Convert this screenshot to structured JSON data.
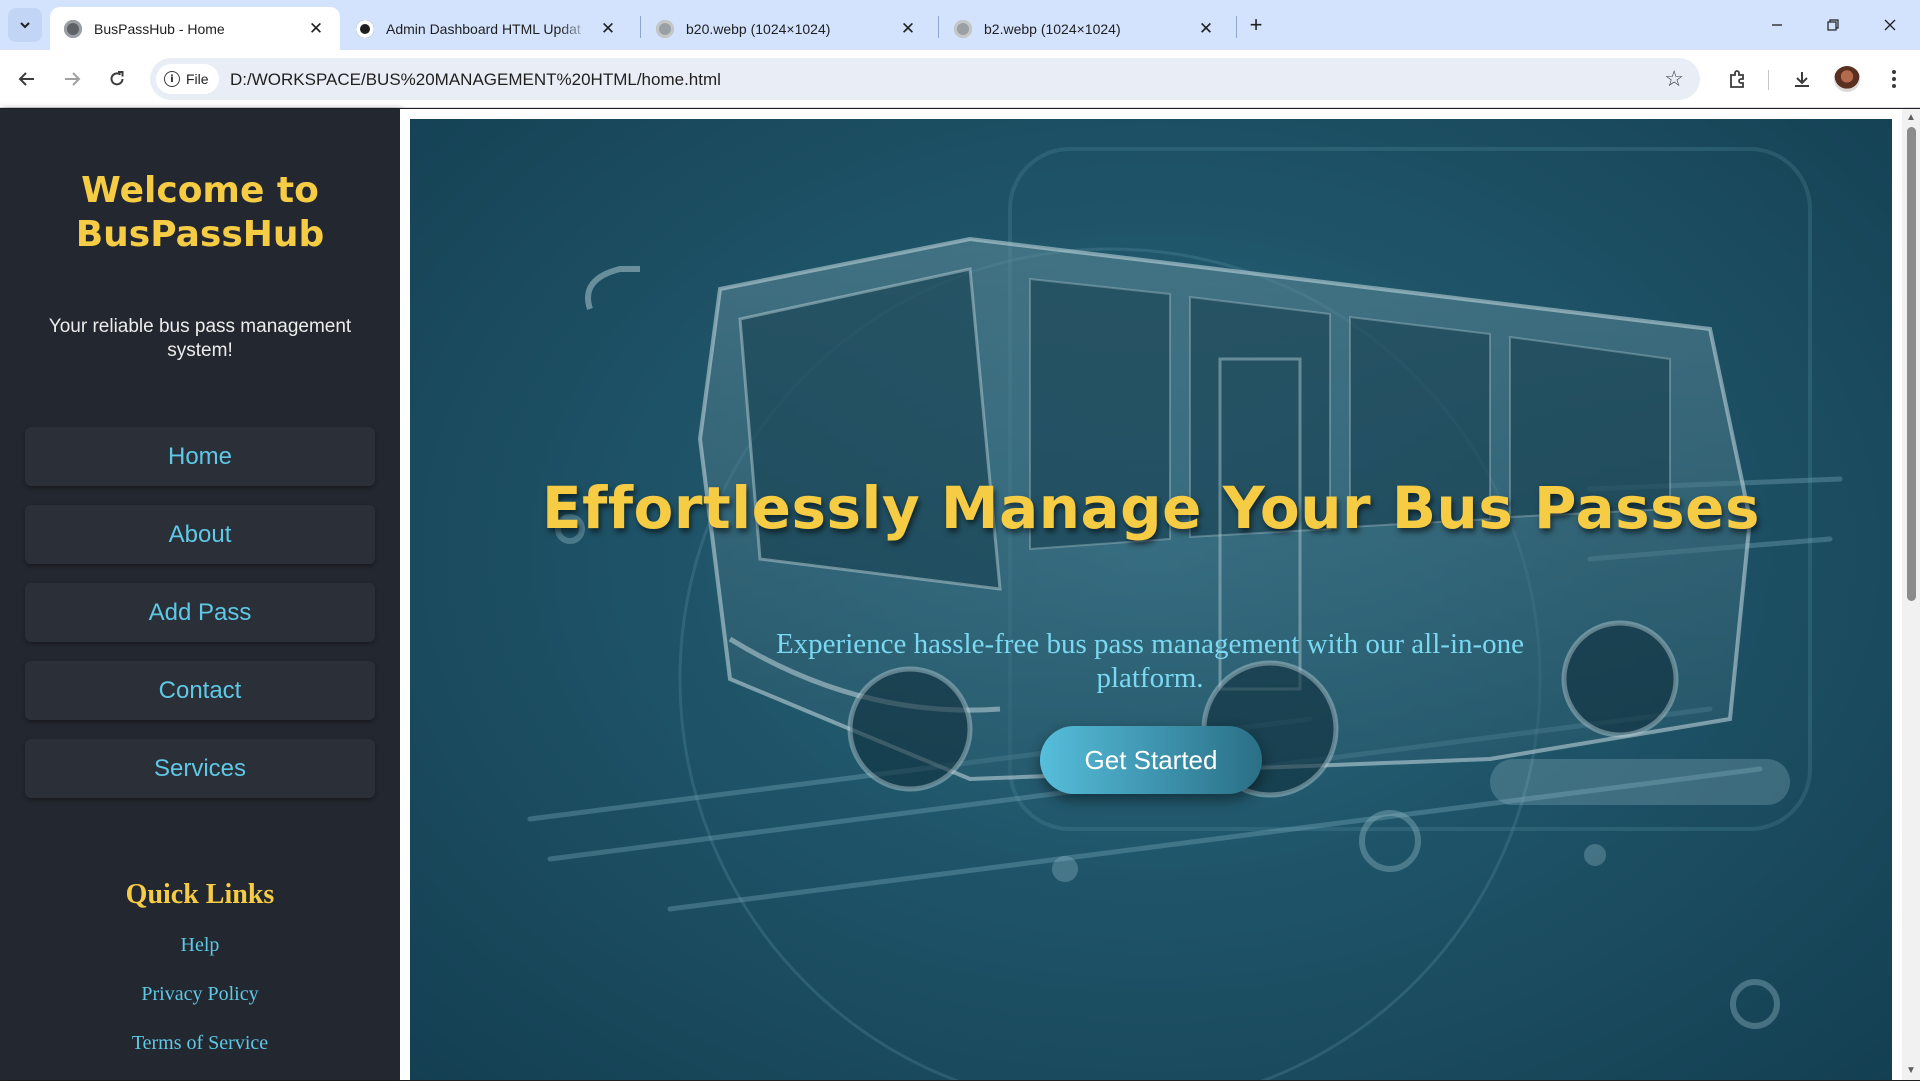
{
  "browser": {
    "tabs": [
      {
        "title": "BusPassHub - Home",
        "active": true,
        "icon": "globe-icon"
      },
      {
        "title": "Admin Dashboard HTML Updat",
        "active": false,
        "icon": "openai-icon"
      },
      {
        "title": "b20.webp (1024×1024)",
        "active": false,
        "icon": "globe-icon"
      },
      {
        "title": "b2.webp (1024×1024)",
        "active": false,
        "icon": "globe-icon"
      }
    ],
    "address": {
      "chip_label": "File",
      "url": "D:/WORKSPACE/BUS%20MANAGEMENT%20HTML/home.html"
    }
  },
  "sidebar": {
    "brand_line1": "Welcome to",
    "brand_line2": "BusPassHub",
    "tagline": "Your reliable bus pass management system!",
    "nav": [
      {
        "label": "Home"
      },
      {
        "label": "About"
      },
      {
        "label": "Add Pass"
      },
      {
        "label": "Contact"
      },
      {
        "label": "Services"
      }
    ],
    "quick_links_title": "Quick Links",
    "quick_links": [
      {
        "label": "Help"
      },
      {
        "label": "Privacy Policy"
      },
      {
        "label": "Terms of Service"
      }
    ]
  },
  "hero": {
    "headline": "Effortlessly Manage Your Bus Passes",
    "subtext": "Experience hassle-free bus pass management with our all-in-one platform.",
    "cta_label": "Get Started"
  },
  "colors": {
    "accent_gold": "#f6cc45",
    "accent_cyan": "#5ec8e6",
    "sidebar_bg": "#23272f",
    "hero_bg": "#1f5468"
  }
}
